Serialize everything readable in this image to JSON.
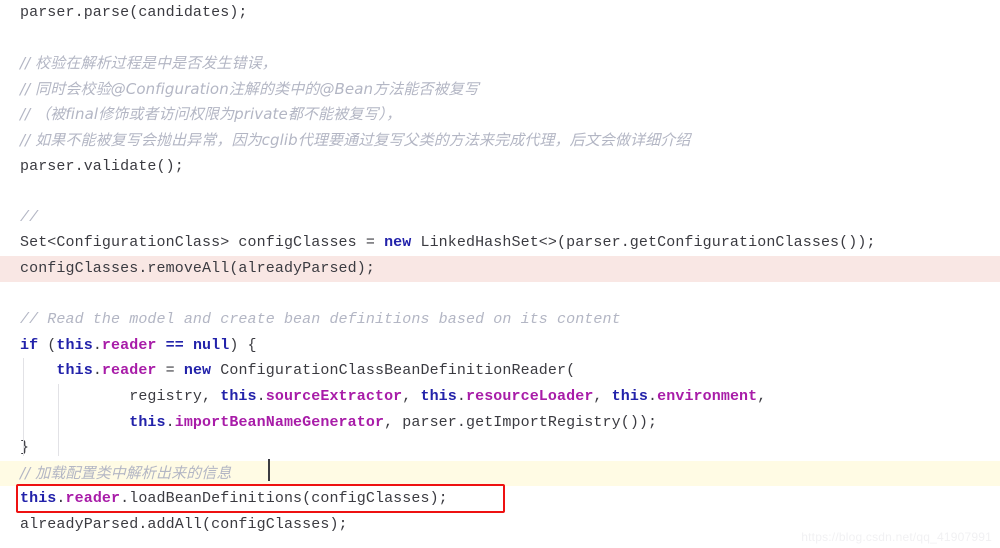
{
  "editor": {
    "colors": {
      "background": "#ffffff",
      "text": "#3b3b41",
      "keyword": "#2222aa",
      "field": "#a81ca8",
      "comment": "#b3b6c4",
      "highlight_pink": "#f9e7e4",
      "highlight_yellow": "#fffbe4",
      "annotation_red": "#ee1111",
      "guide": "#e2e2e6"
    },
    "watermark": "https://blog.csdn.net/qq_41907991",
    "caret": {
      "line_index": 17,
      "after_text": "// 加载配置类中解析出来的信息"
    },
    "annotation": {
      "type": "red-rectangle",
      "target_line_index": 18,
      "target_text": "this.reader.loadBeanDefinitions(configClasses);"
    },
    "lines": [
      {
        "index": 0,
        "highlight": "none",
        "tokens": [
          {
            "t": "parser.parse(candidates);",
            "c": "plain"
          }
        ]
      },
      {
        "index": 1,
        "highlight": "none",
        "tokens": []
      },
      {
        "index": 2,
        "highlight": "none",
        "tokens": [
          {
            "t": "// 校验在解析过程是中是否发生错误，",
            "c": "cmt-cn"
          }
        ]
      },
      {
        "index": 3,
        "highlight": "none",
        "tokens": [
          {
            "t": "// 同时会校验@Configuration注解的类中的@Bean方法能否被复写",
            "c": "cmt-cn"
          }
        ]
      },
      {
        "index": 4,
        "highlight": "none",
        "tokens": [
          {
            "t": "// （被final修饰或者访问权限为private都不能被复写），",
            "c": "cmt-cn"
          }
        ]
      },
      {
        "index": 5,
        "highlight": "none",
        "tokens": [
          {
            "t": "// 如果不能被复写会抛出异常，因为cglib代理要通过复写父类的方法来完成代理，后文会做详细介绍",
            "c": "cmt-cn"
          }
        ]
      },
      {
        "index": 6,
        "highlight": "none",
        "tokens": [
          {
            "t": "parser.validate();",
            "c": "plain"
          }
        ]
      },
      {
        "index": 7,
        "highlight": "none",
        "tokens": []
      },
      {
        "index": 8,
        "highlight": "none",
        "tokens": [
          {
            "t": "//",
            "c": "cmt"
          }
        ]
      },
      {
        "index": 9,
        "highlight": "none",
        "tokens": [
          {
            "t": "Set<ConfigurationClass> configClasses = ",
            "c": "plain"
          },
          {
            "t": "new",
            "c": "kw"
          },
          {
            "t": " LinkedHashSet<>(parser.getConfigurationClasses());",
            "c": "plain"
          }
        ]
      },
      {
        "index": 10,
        "highlight": "pink",
        "tokens": [
          {
            "t": "configClasses.removeAll(alreadyParsed);",
            "c": "plain"
          }
        ]
      },
      {
        "index": 11,
        "highlight": "none",
        "tokens": []
      },
      {
        "index": 12,
        "highlight": "none",
        "tokens": [
          {
            "t": "// Read the model and create bean definitions based on its content",
            "c": "cmt"
          }
        ]
      },
      {
        "index": 13,
        "highlight": "none",
        "tokens": [
          {
            "t": "if",
            "c": "kw"
          },
          {
            "t": " (",
            "c": "plain"
          },
          {
            "t": "this",
            "c": "kw"
          },
          {
            "t": ".",
            "c": "plain"
          },
          {
            "t": "reader",
            "c": "field"
          },
          {
            "t": " ",
            "c": "plain"
          },
          {
            "t": "==",
            "c": "op"
          },
          {
            "t": " ",
            "c": "plain"
          },
          {
            "t": "null",
            "c": "kw"
          },
          {
            "t": ") {",
            "c": "plain"
          }
        ]
      },
      {
        "index": 14,
        "highlight": "none",
        "tokens": [
          {
            "t": "    ",
            "c": "plain"
          },
          {
            "t": "this",
            "c": "kw"
          },
          {
            "t": ".",
            "c": "plain"
          },
          {
            "t": "reader",
            "c": "field"
          },
          {
            "t": " = ",
            "c": "plain"
          },
          {
            "t": "new",
            "c": "kw"
          },
          {
            "t": " ConfigurationClassBeanDefinitionReader(",
            "c": "plain"
          }
        ]
      },
      {
        "index": 15,
        "highlight": "none",
        "tokens": [
          {
            "t": "            registry, ",
            "c": "plain"
          },
          {
            "t": "this",
            "c": "kw"
          },
          {
            "t": ".",
            "c": "plain"
          },
          {
            "t": "sourceExtractor",
            "c": "field"
          },
          {
            "t": ", ",
            "c": "plain"
          },
          {
            "t": "this",
            "c": "kw"
          },
          {
            "t": ".",
            "c": "plain"
          },
          {
            "t": "resourceLoader",
            "c": "field"
          },
          {
            "t": ", ",
            "c": "plain"
          },
          {
            "t": "this",
            "c": "kw"
          },
          {
            "t": ".",
            "c": "plain"
          },
          {
            "t": "environment",
            "c": "field"
          },
          {
            "t": ",",
            "c": "plain"
          }
        ]
      },
      {
        "index": 16,
        "highlight": "none",
        "tokens": [
          {
            "t": "            ",
            "c": "plain"
          },
          {
            "t": "this",
            "c": "kw"
          },
          {
            "t": ".",
            "c": "plain"
          },
          {
            "t": "importBeanNameGenerator",
            "c": "field"
          },
          {
            "t": ", parser.getImportRegistry());",
            "c": "plain"
          }
        ]
      },
      {
        "index": 17,
        "highlight": "none",
        "tokens": [
          {
            "t": "}",
            "c": "plain"
          }
        ]
      },
      {
        "index": 18,
        "highlight": "yellow",
        "tokens": [
          {
            "t": "// 加载配置类中解析出来的信息",
            "c": "cmt-cn"
          }
        ]
      },
      {
        "index": 19,
        "highlight": "none",
        "tokens": [
          {
            "t": "this",
            "c": "kw"
          },
          {
            "t": ".",
            "c": "plain"
          },
          {
            "t": "reader",
            "c": "field"
          },
          {
            "t": ".loadBeanDefinitions(configClasses);",
            "c": "plain"
          }
        ]
      },
      {
        "index": 20,
        "highlight": "none",
        "tokens": [
          {
            "t": "alreadyParsed.addAll(configClasses);",
            "c": "plain"
          }
        ]
      }
    ]
  }
}
